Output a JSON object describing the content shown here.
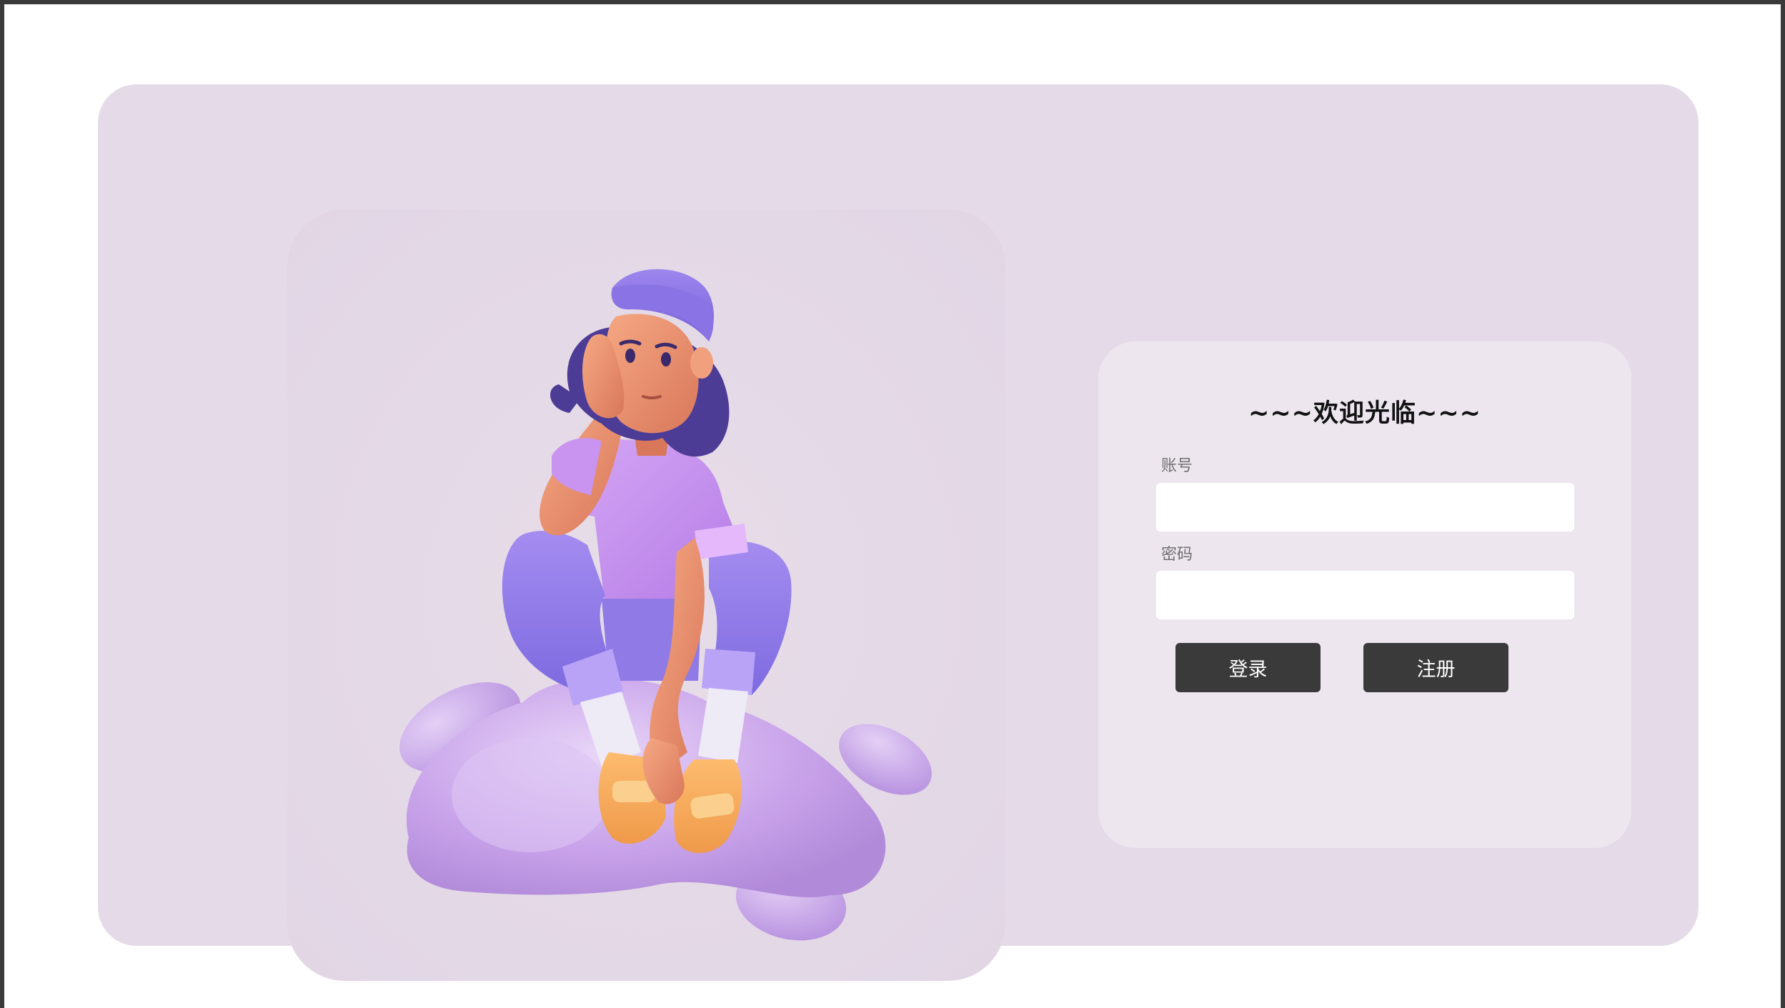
{
  "login": {
    "title": "~~~欢迎光临~~~",
    "account_label": "账号",
    "account_value": "",
    "password_label": "密码",
    "password_value": "",
    "login_button": "登录",
    "register_button": "注册"
  },
  "illustration": {
    "description_icon": "girl-sitting-on-cloud-illustration"
  },
  "colors": {
    "page_background": "#ffffff",
    "card_background": "#e5dbe8",
    "panel_background": "#ede6ef",
    "button_background": "#3a3a3a",
    "button_text": "#ffffff"
  }
}
